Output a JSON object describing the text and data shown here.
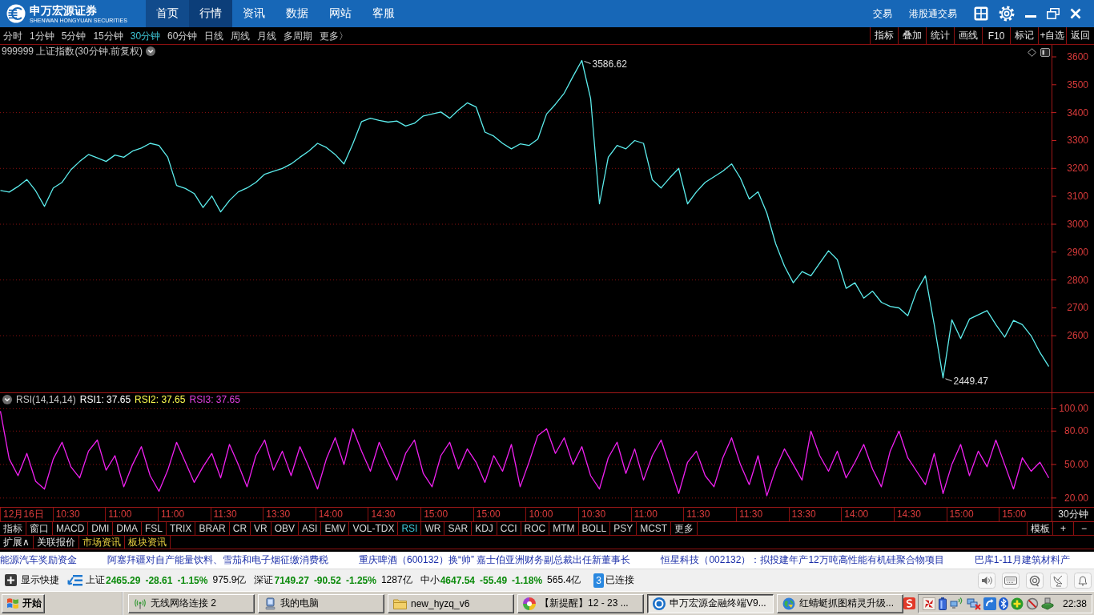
{
  "header": {
    "logo": {
      "name": "申万宏源证券",
      "tagline": "SHENWAN HONGYUAN SECURITIES"
    },
    "nav": [
      {
        "label": "首页",
        "selected": false,
        "hover": true
      },
      {
        "label": "行情",
        "selected": true,
        "hover": false
      },
      {
        "label": "资讯",
        "selected": false,
        "hover": false
      },
      {
        "label": "数据",
        "selected": false,
        "hover": false
      },
      {
        "label": "网站",
        "selected": false,
        "hover": false
      },
      {
        "label": "客服",
        "selected": false,
        "hover": false
      }
    ],
    "links": [
      "交易",
      "港股通交易"
    ]
  },
  "periods": {
    "items": [
      {
        "label": "分时",
        "selected": false
      },
      {
        "label": "1分钟",
        "selected": false
      },
      {
        "label": "5分钟",
        "selected": false
      },
      {
        "label": "15分钟",
        "selected": false
      },
      {
        "label": "30分钟",
        "selected": true
      },
      {
        "label": "60分钟",
        "selected": false
      },
      {
        "label": "日线",
        "selected": false
      },
      {
        "label": "周线",
        "selected": false
      },
      {
        "label": "月线",
        "selected": false
      },
      {
        "label": "多周期",
        "selected": false
      },
      {
        "label": "更多〉",
        "selected": false
      }
    ],
    "tools": [
      "指标",
      "叠加",
      "统计",
      "画线",
      "F10",
      "标记",
      "+自选",
      "返回"
    ]
  },
  "price_chart": {
    "chart_data": {
      "type": "line",
      "title": "999999 上证指数(30分钟.前复权)",
      "series": [
        {
          "color": "#5cecec",
          "values": [
            3121,
            3115,
            3135,
            3160,
            3120,
            3064,
            3130,
            3150,
            3195,
            3225,
            3250,
            3238,
            3225,
            3248,
            3240,
            3262,
            3273,
            3290,
            3282,
            3240,
            3139,
            3128,
            3110,
            3060,
            3101,
            3044,
            3085,
            3116,
            3130,
            3150,
            3179,
            3190,
            3200,
            3216,
            3240,
            3262,
            3290,
            3275,
            3250,
            3216,
            3288,
            3368,
            3380,
            3372,
            3366,
            3370,
            3352,
            3362,
            3388,
            3395,
            3402,
            3380,
            3410,
            3435,
            3420,
            3330,
            3316,
            3290,
            3270,
            3288,
            3282,
            3305,
            3395,
            3430,
            3470,
            3530,
            3587,
            3450,
            3073,
            3240,
            3282,
            3270,
            3300,
            3290,
            3159,
            3130,
            3167,
            3200,
            3073,
            3116,
            3150,
            3170,
            3190,
            3216,
            3165,
            3090,
            3116,
            3040,
            2930,
            2850,
            2790,
            2830,
            2815,
            2860,
            2905,
            2873,
            2770,
            2790,
            2735,
            2760,
            2720,
            2705,
            2700,
            2672,
            2760,
            2815,
            2640,
            2449,
            2657,
            2590,
            2660,
            2675,
            2690,
            2640,
            2595,
            2655,
            2640,
            2600,
            2540,
            2490
          ]
        }
      ],
      "ylim": [
        2397,
        3643
      ],
      "yticks": [
        2600,
        2700,
        2800,
        2900,
        3000,
        3100,
        3200,
        3300,
        3400,
        3500,
        3600
      ],
      "grid": true
    },
    "extreme_labels": [
      {
        "label": "3586.62",
        "kind": "high"
      },
      {
        "label": "2449.47",
        "kind": "low"
      }
    ]
  },
  "rsi_chart": {
    "legend": [
      {
        "label": "RSI1: 37.65",
        "color": "#ffffff"
      },
      {
        "label": "RSI2: 37.65",
        "color": "#ffff50"
      },
      {
        "label": "RSI3: 37.65",
        "color": "#e040e0"
      }
    ],
    "chart_data": {
      "type": "line",
      "title": "RSI(14,14,14)",
      "series": [
        {
          "color": "#f020f0",
          "values": [
            98,
            55,
            40,
            60,
            35,
            28,
            55,
            70,
            48,
            38,
            62,
            72,
            45,
            58,
            30,
            50,
            66,
            40,
            26,
            45,
            70,
            52,
            34,
            48,
            60,
            38,
            68,
            50,
            30,
            58,
            72,
            45,
            62,
            40,
            66,
            48,
            28,
            55,
            74,
            50,
            82,
            62,
            44,
            70,
            52,
            36,
            60,
            72,
            42,
            30,
            58,
            70,
            46,
            64,
            52,
            34,
            58,
            44,
            68,
            30,
            52,
            76,
            82,
            60,
            74,
            50,
            66,
            40,
            28,
            56,
            70,
            42,
            64,
            36,
            58,
            72,
            48,
            24,
            52,
            62,
            40,
            30,
            56,
            74,
            50,
            32,
            58,
            22,
            46,
            64,
            50,
            36,
            80,
            58,
            44,
            62,
            38,
            52,
            68,
            46,
            30,
            62,
            80,
            56,
            44,
            32,
            60,
            24,
            50,
            68,
            40,
            62,
            48,
            72,
            50,
            28,
            56,
            44,
            52,
            38
          ]
        }
      ],
      "ylim": [
        12,
        114
      ],
      "yticks": [
        {
          "value": 20,
          "label": "20.00"
        },
        {
          "value": 50,
          "label": "50.00"
        },
        {
          "value": 80,
          "label": "80.00"
        },
        {
          "value": 100,
          "label": "100.00"
        }
      ],
      "grid": true
    }
  },
  "time_axis": {
    "labels": [
      "12月16日",
      "10:30",
      "11:00",
      "11:00",
      "11:30",
      "13:30",
      "14:00",
      "14:30",
      "15:00",
      "15:00",
      "10:00",
      "10:30",
      "11:00",
      "11:30",
      "11:30",
      "13:30",
      "14:00",
      "14:30",
      "15:00",
      "15:00"
    ],
    "unit": "30分钟"
  },
  "indicator_tabs": {
    "items": [
      {
        "label": "指标",
        "selected": false
      },
      {
        "label": "窗口",
        "selected": false
      },
      {
        "label": "MACD",
        "selected": false
      },
      {
        "label": "DMI",
        "selected": false
      },
      {
        "label": "DMA",
        "selected": false
      },
      {
        "label": "FSL",
        "selected": false
      },
      {
        "label": "TRIX",
        "selected": false
      },
      {
        "label": "BRAR",
        "selected": false
      },
      {
        "label": "CR",
        "selected": false
      },
      {
        "label": "VR",
        "selected": false
      },
      {
        "label": "OBV",
        "selected": false
      },
      {
        "label": "ASI",
        "selected": false
      },
      {
        "label": "EMV",
        "selected": false
      },
      {
        "label": "VOL-TDX",
        "selected": false
      },
      {
        "label": "RSI",
        "selected": true
      },
      {
        "label": "WR",
        "selected": false
      },
      {
        "label": "SAR",
        "selected": false
      },
      {
        "label": "KDJ",
        "selected": false
      },
      {
        "label": "CCI",
        "selected": false
      },
      {
        "label": "ROC",
        "selected": false
      },
      {
        "label": "MTM",
        "selected": false
      },
      {
        "label": "BOLL",
        "selected": false
      },
      {
        "label": "PSY",
        "selected": false
      },
      {
        "label": "MCST",
        "selected": false
      },
      {
        "label": "更多",
        "selected": false
      }
    ],
    "actions": [
      "模板",
      "+",
      "−"
    ]
  },
  "extension_tabs": [
    {
      "label": "扩展∧",
      "highlighted": false
    },
    {
      "label": "关联报价",
      "highlighted": false
    },
    {
      "label": "市场资讯",
      "highlighted": true
    },
    {
      "label": "板块资讯",
      "highlighted": true
    }
  ],
  "news_ticker": [
    "能源汽车奖励资金",
    "阿塞拜疆对自产能量饮料、雪茄和电子烟征缴消费税",
    "重庆啤酒（600132）换“帅” 嘉士伯亚洲财务副总裁出任新董事长",
    "恒星科技（002132）：拟投建年产12万吨高性能有机硅聚合物项目",
    "巴库1-11月建筑材料产"
  ],
  "status_bar": {
    "shortcut": "显示快捷",
    "indices": [
      {
        "name": "上证",
        "value": "2465.29",
        "change": "-28.61",
        "percent": "-1.15%",
        "turnover": "975.9亿",
        "falling": true
      },
      {
        "name": "深证",
        "value": "7149.27",
        "change": "-90.52",
        "percent": "-1.25%",
        "turnover": "1287亿",
        "falling": true
      },
      {
        "name": "中小",
        "value": "4647.54",
        "change": "-55.49",
        "percent": "-1.18%",
        "turnover": "565.4亿",
        "falling": true
      }
    ],
    "connection": {
      "count": "3",
      "label": "已连接"
    }
  },
  "taskbar": {
    "start": "开始",
    "tasks": [
      {
        "label": "无线网络连接 2",
        "selected": false
      },
      {
        "label": "我的电脑",
        "selected": false
      },
      {
        "label": "new_hyzq_v6",
        "selected": false
      },
      {
        "label": "【新提醒】12 - 23 ...",
        "selected": false
      },
      {
        "label": "申万宏源金融终端V9...",
        "selected": true
      },
      {
        "label": "红蜻蜓抓图精灵升级...",
        "selected": false
      }
    ],
    "clock": "22:38"
  }
}
